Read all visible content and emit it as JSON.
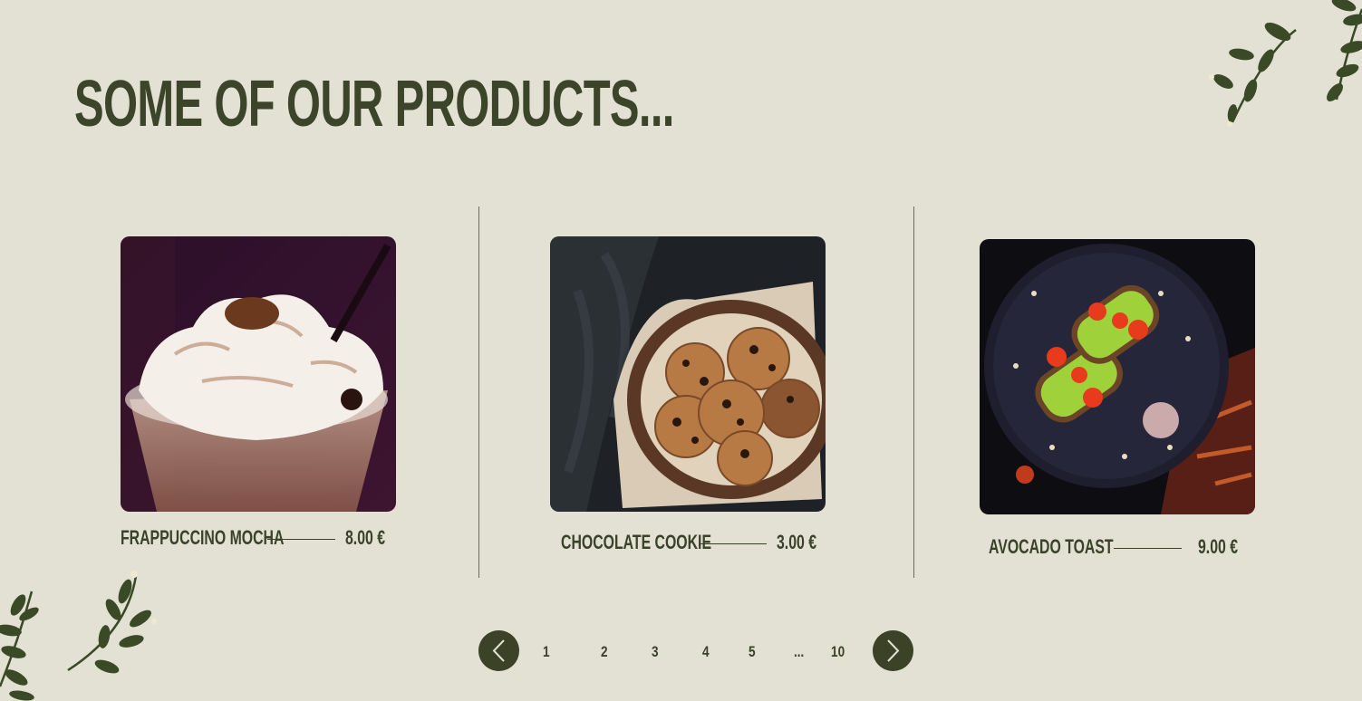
{
  "header": {
    "title": "SOME OF OUR PRODUCTS..."
  },
  "products": [
    {
      "name": "FRAPPUCCINO MOCHA",
      "price": "8.00 €",
      "image_icon": "frappuccino-photo"
    },
    {
      "name": "CHOCOLATE COOKIE",
      "price": "3.00 €",
      "image_icon": "cookie-photo"
    },
    {
      "name": "AVOCADO TOAST",
      "price": "9.00 €",
      "image_icon": "avocado-toast-photo"
    }
  ],
  "pagination": {
    "prev_icon": "chevron-left-icon",
    "next_icon": "chevron-right-icon",
    "pages": [
      "1",
      "2",
      "3",
      "4",
      "5",
      "...",
      "10"
    ]
  },
  "colors": {
    "background": "#e2e1d4",
    "accent": "#3b4228"
  },
  "decorations": [
    "leaf-branch-icon"
  ]
}
